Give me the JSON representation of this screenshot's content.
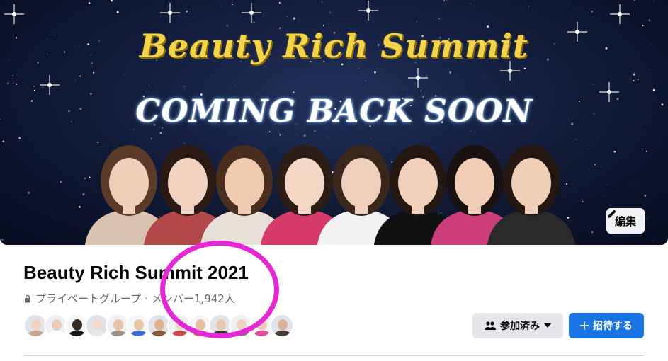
{
  "cover": {
    "title": "Beauty Rich Summit",
    "subtitle": "COMING BACK SOON",
    "edit_label": "編集"
  },
  "group": {
    "name": "Beauty Rich Summit 2021",
    "privacy": "プライベートグループ",
    "separator": "·",
    "members_label": "メンバー1,942人"
  },
  "members_preview": [
    {
      "skin": "#f0d2bf",
      "cloth": "#c9a48e"
    },
    {
      "skin": "#eccab6",
      "cloth": "#ffffff"
    },
    {
      "skin": "#3b2a20",
      "cloth": "#1a1a1a"
    },
    {
      "skin": "#f2d9c8",
      "cloth": "#e8e8e8"
    },
    {
      "skin": "#e6c2a8",
      "cloth": "#9c8f86"
    },
    {
      "skin": "#e8c7a6",
      "cloth": "#3a6fd8"
    },
    {
      "skin": "#ddb38f",
      "cloth": "#8a5a3c"
    },
    {
      "skin": "#f3dac6",
      "cloth": "#c94a4a"
    },
    {
      "skin": "#e7c0a2",
      "cloth": "#c86a2a"
    },
    {
      "skin": "#e9c9b0",
      "cloth": "#333333"
    },
    {
      "skin": "#eed4c0",
      "cloth": "#7a7a7a"
    },
    {
      "skin": "#f0ccb8",
      "cloth": "#e04fa0"
    },
    {
      "skin": "#d9b49a",
      "cloth": "#4a3b33"
    }
  ],
  "actions": {
    "joined_label": "参加済み",
    "invite_label": "招待する"
  },
  "colors": {
    "primary": "#1b74e4",
    "secondary_button": "#e4e6eb",
    "annotation": "#e528d6"
  }
}
